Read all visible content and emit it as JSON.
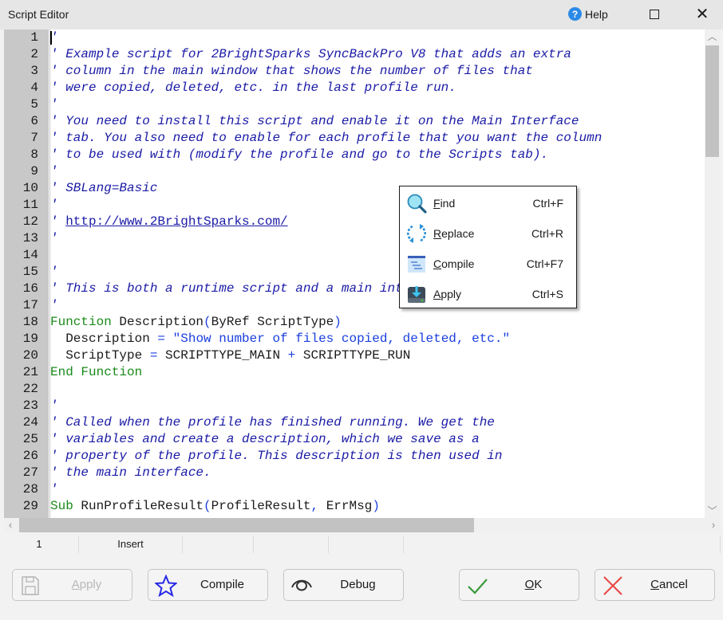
{
  "window": {
    "title": "Script Editor",
    "help_label": "Help",
    "maximize_label": "Maximize",
    "close_label": "Close"
  },
  "editor": {
    "lines": [
      {
        "n": "1",
        "segs": [
          {
            "t": "'",
            "c": "cmt"
          }
        ]
      },
      {
        "n": "2",
        "segs": [
          {
            "t": "' Example script for 2BrightSparks SyncBackPro V8 that adds an extra",
            "c": "cmt"
          }
        ]
      },
      {
        "n": "3",
        "segs": [
          {
            "t": "' column in the main window that shows the number of files that",
            "c": "cmt"
          }
        ]
      },
      {
        "n": "4",
        "segs": [
          {
            "t": "' were copied, deleted, etc. in the last profile run.",
            "c": "cmt"
          }
        ]
      },
      {
        "n": "5",
        "segs": [
          {
            "t": "'",
            "c": "cmt"
          }
        ]
      },
      {
        "n": "6",
        "segs": [
          {
            "t": "' You need to install this script and enable it on the Main Interface",
            "c": "cmt"
          }
        ]
      },
      {
        "n": "7",
        "segs": [
          {
            "t": "' tab. You also need to enable for each profile that you want the column",
            "c": "cmt"
          }
        ]
      },
      {
        "n": "8",
        "segs": [
          {
            "t": "' to be used with (modify the profile and go to the Scripts tab).",
            "c": "cmt"
          }
        ]
      },
      {
        "n": "9",
        "segs": [
          {
            "t": "'",
            "c": "cmt"
          }
        ]
      },
      {
        "n": "10",
        "segs": [
          {
            "t": "' SBLang=Basic",
            "c": "cmt"
          }
        ]
      },
      {
        "n": "11",
        "segs": [
          {
            "t": "'",
            "c": "cmt"
          }
        ]
      },
      {
        "n": "12",
        "segs": [
          {
            "t": "' ",
            "c": "cmt"
          },
          {
            "t": "http://www.2BrightSparks.com/",
            "c": "link"
          }
        ]
      },
      {
        "n": "13",
        "segs": [
          {
            "t": "'",
            "c": "cmt"
          }
        ]
      },
      {
        "n": "14",
        "segs": []
      },
      {
        "n": "15",
        "segs": [
          {
            "t": "'",
            "c": "cmt"
          }
        ]
      },
      {
        "n": "16",
        "segs": [
          {
            "t": "' This is both a runtime script and a main interface script",
            "c": "cmt"
          }
        ]
      },
      {
        "n": "17",
        "segs": [
          {
            "t": "'",
            "c": "cmt"
          }
        ]
      },
      {
        "n": "18",
        "segs": [
          {
            "t": "Function",
            "c": "kw"
          },
          {
            "t": " Description",
            "c": "txt"
          },
          {
            "t": "(",
            "c": "str"
          },
          {
            "t": "ByRef ScriptType",
            "c": "txt"
          },
          {
            "t": ")",
            "c": "str"
          }
        ]
      },
      {
        "n": "19",
        "segs": [
          {
            "t": "  Description ",
            "c": "txt"
          },
          {
            "t": "=",
            "c": "str"
          },
          {
            "t": " \"Show number of files copied, deleted, etc.\"",
            "c": "str"
          }
        ]
      },
      {
        "n": "20",
        "segs": [
          {
            "t": "  ScriptType ",
            "c": "txt"
          },
          {
            "t": "=",
            "c": "str"
          },
          {
            "t": " SCRIPTTYPE_MAIN ",
            "c": "txt"
          },
          {
            "t": "+",
            "c": "str"
          },
          {
            "t": " SCRIPTTYPE_RUN",
            "c": "txt"
          }
        ]
      },
      {
        "n": "21",
        "segs": [
          {
            "t": "End Function",
            "c": "kw"
          }
        ]
      },
      {
        "n": "22",
        "segs": []
      },
      {
        "n": "23",
        "segs": [
          {
            "t": "'",
            "c": "cmt"
          }
        ]
      },
      {
        "n": "24",
        "segs": [
          {
            "t": "' Called when the profile has finished running. We get the",
            "c": "cmt"
          }
        ]
      },
      {
        "n": "25",
        "segs": [
          {
            "t": "' variables and create a description, which we save as a",
            "c": "cmt"
          }
        ]
      },
      {
        "n": "26",
        "segs": [
          {
            "t": "' property of the profile. This description is then used in",
            "c": "cmt"
          }
        ]
      },
      {
        "n": "27",
        "segs": [
          {
            "t": "' the main interface.",
            "c": "cmt"
          }
        ]
      },
      {
        "n": "28",
        "segs": [
          {
            "t": "'",
            "c": "cmt"
          }
        ]
      },
      {
        "n": "29",
        "segs": [
          {
            "t": "Sub",
            "c": "kw"
          },
          {
            "t": " RunProfileResult",
            "c": "txt"
          },
          {
            "t": "(",
            "c": "str"
          },
          {
            "t": "ProfileResult",
            "c": "txt"
          },
          {
            "t": ",",
            "c": "str"
          },
          {
            "t": " ErrMsg",
            "c": "txt"
          },
          {
            "t": ")",
            "c": "str"
          }
        ]
      }
    ]
  },
  "context_menu": {
    "items": [
      {
        "label": "Find",
        "accel": "F",
        "rest": "ind",
        "shortcut": "Ctrl+F",
        "icon": "magnifier-icon"
      },
      {
        "label": "Replace",
        "accel": "R",
        "rest": "eplace",
        "shortcut": "Ctrl+R",
        "icon": "replace-cycle-icon"
      },
      {
        "label": "Compile",
        "accel": "C",
        "rest": "ompile",
        "shortcut": "Ctrl+F7",
        "icon": "compile-document-icon"
      },
      {
        "label": "Apply",
        "accel": "A",
        "rest": "pply",
        "shortcut": "Ctrl+S",
        "icon": "drive-download-icon"
      }
    ]
  },
  "status": {
    "line": "1",
    "mode": "Insert",
    "cell3": "",
    "cell4": "",
    "cell5": ""
  },
  "buttons": {
    "apply": {
      "accel": "A",
      "rest": "pply",
      "enabled": false
    },
    "compile": {
      "label": "Compile"
    },
    "debug": {
      "label": "Debug"
    },
    "ok": {
      "accel": "O",
      "rest": "K"
    },
    "cancel": {
      "accel": "C",
      "rest": "ancel"
    }
  },
  "colors": {
    "comment": "#1a1aa6",
    "keyword": "#1b8a1b",
    "string": "#1a3fe0",
    "gutter": "#c8c8c8",
    "help_icon": "#2b8ae6",
    "ok_check": "#3a9a3a",
    "cancel_x": "#e84a4a",
    "compile_star": "#2a2ae8"
  }
}
